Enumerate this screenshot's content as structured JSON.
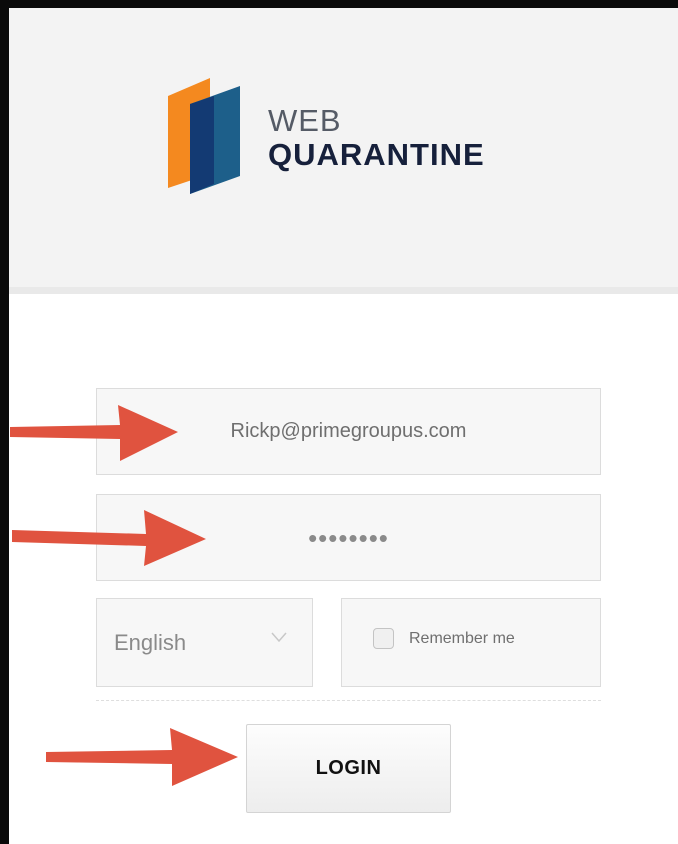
{
  "logo": {
    "line1": "WEB",
    "line2": "QUARANTINE",
    "icon": "book-logo-icon",
    "colors": {
      "orange": "#f4891f",
      "navy": "#133a73",
      "teal": "#1d5f8a"
    }
  },
  "login_form": {
    "email_value": "Rickp@primegroupus.com",
    "password_mask": "••••••••",
    "language_selected": "English",
    "remember_label": "Remember me",
    "login_label": "LOGIN"
  },
  "annotations": {
    "arrow_icon": "red-arrow-icon",
    "arrow_color": "#e0533f"
  }
}
